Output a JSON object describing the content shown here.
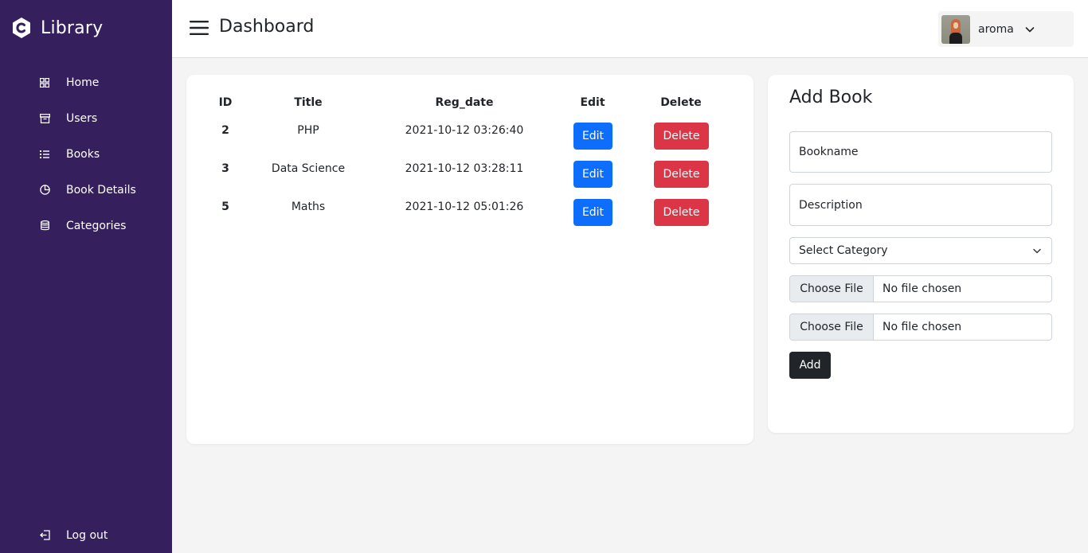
{
  "brand": {
    "name": "Library",
    "icon": "c-logo-icon"
  },
  "sidebar": {
    "items": [
      {
        "label": "Home",
        "icon": "grid-icon"
      },
      {
        "label": "Users",
        "icon": "archive-icon"
      },
      {
        "label": "Books",
        "icon": "list-icon"
      },
      {
        "label": "Book Details",
        "icon": "pie-chart-icon"
      },
      {
        "label": "Categories",
        "icon": "database-icon"
      }
    ],
    "logout": {
      "label": "Log out",
      "icon": "logout-icon"
    }
  },
  "header": {
    "title": "Dashboard",
    "user": {
      "name": "aroma"
    }
  },
  "table": {
    "columns": [
      "ID",
      "Title",
      "Reg_date",
      "Edit",
      "Delete"
    ],
    "rows": [
      {
        "id": "2",
        "title": "PHP",
        "reg_date": "2021-10-12 03:26:40",
        "edit": "Edit",
        "delete": "Delete"
      },
      {
        "id": "3",
        "title": "Data Science",
        "reg_date": "2021-10-12 03:28:11",
        "edit": "Edit",
        "delete": "Delete"
      },
      {
        "id": "5",
        "title": "Maths",
        "reg_date": "2021-10-12 05:01:26",
        "edit": "Edit",
        "delete": "Delete"
      }
    ]
  },
  "form": {
    "title": "Add Book",
    "bookname_placeholder": "Bookname",
    "description_placeholder": "Description",
    "category_selected": "Select Category",
    "file1": {
      "button": "Choose File",
      "status": "No file chosen"
    },
    "file2": {
      "button": "Choose File",
      "status": "No file chosen"
    },
    "submit": "Add"
  },
  "colors": {
    "sidebar": "#35205d",
    "primary": "#0d6efd",
    "danger": "#dc3545",
    "dark": "#212529",
    "background": "#f4f4f5"
  }
}
